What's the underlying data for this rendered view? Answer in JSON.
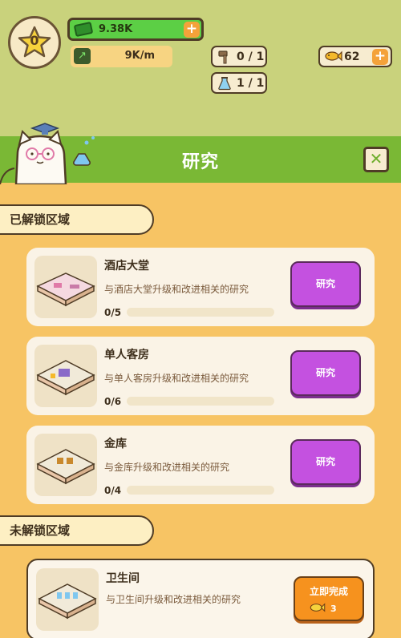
{
  "hud": {
    "level": "0",
    "cash": "9.38K",
    "income": "9K/m",
    "tools": "0 / 1",
    "flasks": "1 / 1",
    "fish": "62"
  },
  "title": "研究",
  "sections": {
    "unlocked": "已解锁区域",
    "locked": "未解锁区域"
  },
  "cards": [
    {
      "name": "酒店大堂",
      "desc": "与酒店大堂升级和改进相关的研究",
      "progress": "0/5",
      "button": "研究"
    },
    {
      "name": "单人客房",
      "desc": "与单人客房升级和改进相关的研究",
      "progress": "0/6",
      "button": "研究"
    },
    {
      "name": "金库",
      "desc": "与金库升级和改进相关的研究",
      "progress": "0/4",
      "button": "研究"
    }
  ],
  "locked_card": {
    "name": "卫生间",
    "desc": "与卫生间升级和改进相关的研究",
    "button": "立即完成",
    "cost": "3"
  },
  "colors": {
    "header_green": "#7ab835",
    "hud_bg": "#c9d27c",
    "panel_bg": "#f7c464",
    "research_button": "#c451e0",
    "complete_button": "#f6921e"
  },
  "icons": [
    "star-icon",
    "cash-icon",
    "income-chart-icon",
    "hammer-icon",
    "flask-icon",
    "fish-icon",
    "close-icon",
    "plus-icon"
  ]
}
